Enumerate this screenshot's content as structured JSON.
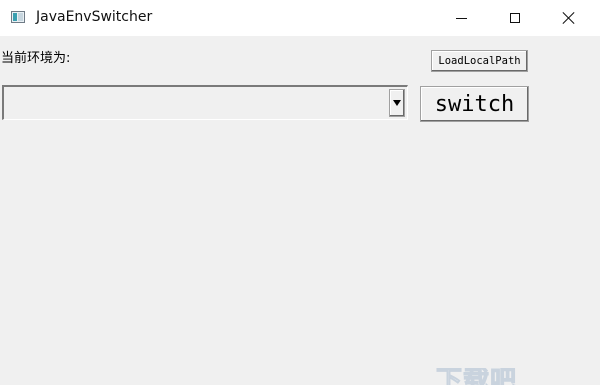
{
  "window": {
    "title": "JavaEnvSwitcher",
    "app_icon": "java-app-icon",
    "controls": {
      "minimize_icon": "minimize-icon",
      "maximize_icon": "maximize-icon",
      "close_icon": "close-icon"
    }
  },
  "main": {
    "current_env_label": "当前环境为:",
    "load_button_label": "LoadLocalPath",
    "env_select_value": "",
    "switch_button_label": "switch"
  },
  "watermark": {
    "text": "下载吧"
  }
}
